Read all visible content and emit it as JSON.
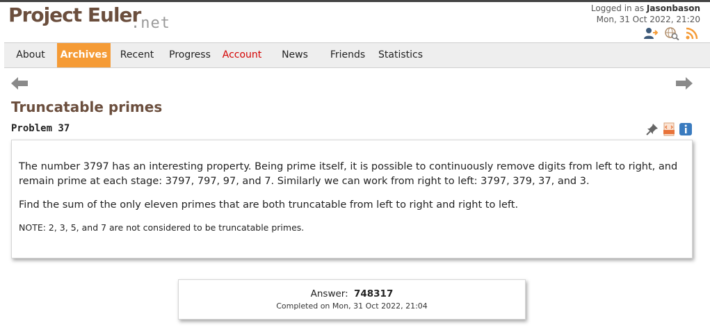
{
  "header": {
    "logo_main": "Project Euler",
    "logo_suffix": ".net",
    "logged_in_prefix": "Logged in as ",
    "username": "Jasonbason",
    "datetime": "Mon, 31 Oct 2022, 21:20",
    "icons": [
      "account-icon",
      "search-globe-icon",
      "rss-feed-icon"
    ]
  },
  "nav": {
    "items": [
      {
        "label": "About"
      },
      {
        "label": "Archives",
        "active": true
      },
      {
        "label": "Recent"
      },
      {
        "label": "Progress"
      },
      {
        "label": "Account",
        "highlight": "#d40000"
      },
      {
        "label": "News"
      },
      {
        "label": "Friends"
      },
      {
        "label": "Statistics"
      }
    ]
  },
  "navigation_arrows": [
    "previous-arrow-icon",
    "next-arrow-icon"
  ],
  "problem": {
    "title": "Truncatable primes",
    "id_label": "Problem 37",
    "icons": [
      "pin-icon",
      "html-file-icon",
      "info-icon"
    ],
    "paragraphs": [
      "The number 3797 has an interesting property. Being prime itself, it is possible to continuously remove digits from left to right, and remain prime at each stage: 3797, 797, 97, and 7. Similarly we can work from right to left: 3797, 379, 37, and 3.",
      "Find the sum of the only eleven primes that are both truncatable from left to right and right to left."
    ],
    "note": "NOTE: 2, 3, 5, and 7 are not considered to be truncatable primes."
  },
  "answer": {
    "label": "Answer:",
    "value": "748317",
    "completed": "Completed on Mon, 31 Oct 2022, 21:04"
  },
  "colors": {
    "brand": "#6b4e3d",
    "accent": "#f59b36",
    "account_link": "#d40000",
    "info_blue": "#3a7bbf"
  }
}
